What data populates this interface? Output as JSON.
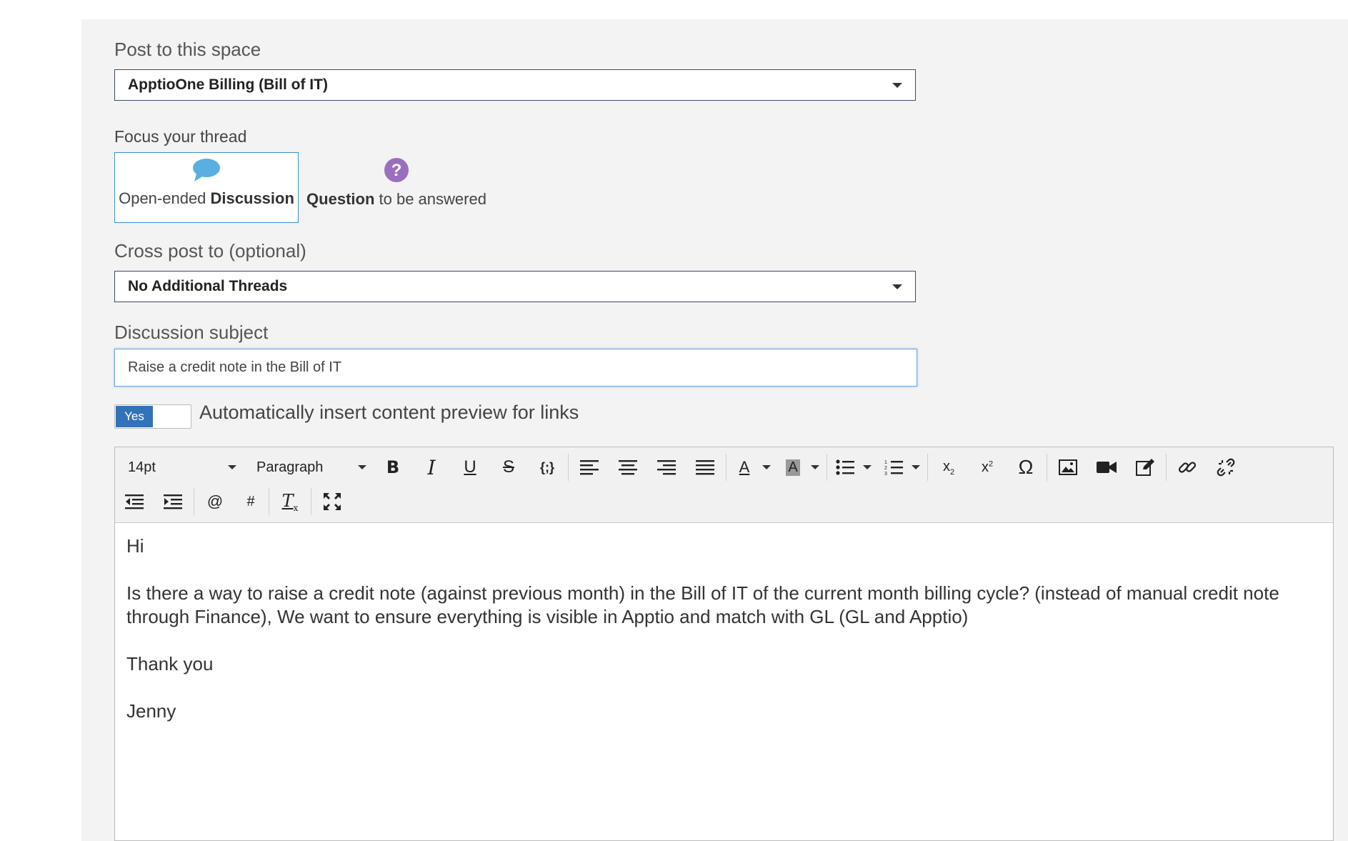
{
  "post_space": {
    "label": "Post to this space",
    "selected": "ApptioOne Billing (Bill of IT)"
  },
  "focus": {
    "label": "Focus your thread",
    "discussion": {
      "prefix": "Open-ended ",
      "bold": "Discussion",
      "icon": "speech-bubble-icon"
    },
    "question": {
      "bold": "Question",
      "suffix": " to be answered",
      "icon": "question-circle-icon"
    }
  },
  "cross_post": {
    "label": "Cross post to (optional)",
    "selected": "No Additional Threads"
  },
  "subject": {
    "label": "Discussion subject",
    "value": "Raise a credit note in the Bill of IT"
  },
  "link_preview": {
    "toggle_text": "Yes",
    "label": "Automatically insert content preview for links"
  },
  "toolbar": {
    "font_size": "14pt",
    "block_format": "Paragraph",
    "buttons_row1": [
      "bold",
      "italic",
      "underline",
      "strikethrough",
      "code",
      "align-left",
      "align-center",
      "align-right",
      "justify",
      "text-color",
      "background-color",
      "bullet-list",
      "numbered-list",
      "subscript",
      "superscript",
      "special-character",
      "image",
      "video",
      "edit",
      "link",
      "unlink"
    ],
    "buttons_row2": [
      "outdent",
      "indent",
      "mention",
      "hashtag",
      "clear-formatting",
      "fullscreen"
    ],
    "mention_symbol": "@",
    "hashtag_symbol": "#",
    "omega_symbol": "Ω",
    "code_symbol": "{;}"
  },
  "body": {
    "greeting": "Hi",
    "paragraph": "Is there a way to raise a credit note (against previous month) in the Bill of IT of the current month billing cycle? (instead of manual credit note through Finance), We want to ensure everything is visible in Apptio and match with GL (GL and Apptio)",
    "closing": "Thank you",
    "signature": "Jenny"
  },
  "colors": {
    "accent": "#3372b8",
    "discussion_icon": "#5aaee0",
    "question_icon": "#9b6fbf",
    "panel_bg": "#f3f3f3"
  }
}
